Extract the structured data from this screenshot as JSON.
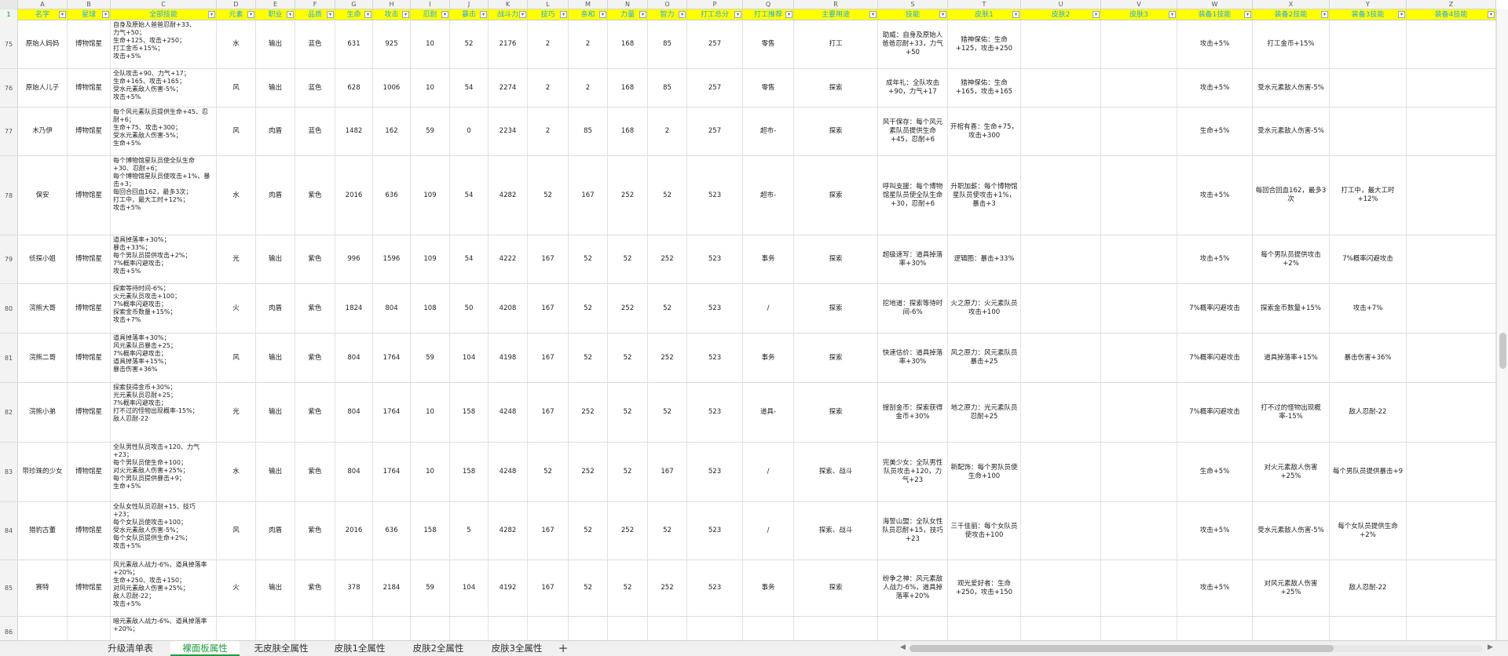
{
  "columns": [
    {
      "letter": "A",
      "header": "名字"
    },
    {
      "letter": "B",
      "header": "星球"
    },
    {
      "letter": "C",
      "header": "全部技能"
    },
    {
      "letter": "D",
      "header": "元素"
    },
    {
      "letter": "E",
      "header": "职业"
    },
    {
      "letter": "F",
      "header": "品质"
    },
    {
      "letter": "G",
      "header": "生命"
    },
    {
      "letter": "H",
      "header": "攻击"
    },
    {
      "letter": "I",
      "header": "忍耐"
    },
    {
      "letter": "J",
      "header": "暴击"
    },
    {
      "letter": "K",
      "header": "战斗力"
    },
    {
      "letter": "L",
      "header": "技巧"
    },
    {
      "letter": "M",
      "header": "亲和"
    },
    {
      "letter": "N",
      "header": "力量"
    },
    {
      "letter": "O",
      "header": "智力"
    },
    {
      "letter": "P",
      "header": "打工总分"
    },
    {
      "letter": "Q",
      "header": "打工推荐"
    },
    {
      "letter": "R",
      "header": "主要用途"
    },
    {
      "letter": "S",
      "header": "技能"
    },
    {
      "letter": "T",
      "header": "皮肤1"
    },
    {
      "letter": "U",
      "header": "皮肤2"
    },
    {
      "letter": "V",
      "header": "皮肤3"
    },
    {
      "letter": "W",
      "header": "装备1技能"
    },
    {
      "letter": "X",
      "header": "装备2技能"
    },
    {
      "letter": "Y",
      "header": "装备3技能"
    },
    {
      "letter": "Z",
      "header": "装备4技能"
    }
  ],
  "header_row_number": "1",
  "rows": [
    {
      "num": "75",
      "cells": [
        "原始人妈妈",
        "博物馆星",
        "自身及原始人爸爸忍耐+33、\n力气+50；\n生命+125、攻击+250；\n打工金币+15%；\n攻击+5%",
        "水",
        "输出",
        "蓝色",
        "631",
        "925",
        "10",
        "52",
        "2176",
        "2",
        "2",
        "168",
        "85",
        "257",
        "零售",
        "打工",
        "助威：自身及原始人爸爸忍耐+33，力气+50",
        "猎神保佑：生命+125，攻击+250",
        "",
        "",
        "攻击+5%",
        "打工金币+15%",
        "",
        ""
      ]
    },
    {
      "num": "76",
      "cells": [
        "原始人儿子",
        "博物馆星",
        "全队攻击+90、力气+17；\n生命+165、攻击+165；\n受水元素敌人伤害-5%；\n攻击+5%",
        "风",
        "输出",
        "蓝色",
        "628",
        "1006",
        "10",
        "54",
        "2274",
        "2",
        "2",
        "168",
        "85",
        "257",
        "零售",
        "探索",
        "成年礼：全队攻击+90，力气+17",
        "猎神保佑：生命+165，攻击+165",
        "",
        "",
        "攻击+5%",
        "受水元素敌人伤害-5%",
        "",
        ""
      ]
    },
    {
      "num": "77",
      "cells": [
        "木乃伊",
        "博物馆星",
        "每个风元素队员提供生命+45、忍耐+6；\n生命+75、攻击+300；\n受水元素敌人伤害-5%；\n生命+5%",
        "风",
        "肉盾",
        "蓝色",
        "1482",
        "162",
        "59",
        "0",
        "2234",
        "2",
        "85",
        "168",
        "2",
        "257",
        "超市-",
        "探索",
        "风干保存：每个风元素队员提供生命+45，忍耐+6",
        "开棺有喜：生命+75，攻击+300",
        "",
        "",
        "生命+5%",
        "受水元素敌人伤害-5%",
        "",
        ""
      ]
    },
    {
      "num": "78",
      "cells": [
        "保安",
        "博物馆星",
        "每个博物馆星队员使全队生命+30、忍耐+6；\n每个博物馆星队员使攻击+1%、暴击+3；\n每回合回血162，最多3次；\n打工中，最大工时+12%；\n攻击+5%",
        "水",
        "肉盾",
        "紫色",
        "2016",
        "636",
        "109",
        "54",
        "4282",
        "52",
        "167",
        "252",
        "52",
        "523",
        "超市-",
        "探索",
        "呼叫支援：每个博物馆星队员使全队生命+30，忍耐+6",
        "升职加薪：每个博物馆星队员使攻击+1%，暴击+3",
        "",
        "",
        "攻击+5%",
        "每回合回血162，最多3次",
        "打工中，最大工时+12%",
        ""
      ]
    },
    {
      "num": "79",
      "cells": [
        "侦探小姐",
        "博物馆星",
        "道具掉落率+30%；\n暴击+33%；\n每个男队员提供攻击+2%；\n7%概率闪避攻击；\n攻击+5%",
        "光",
        "输出",
        "紫色",
        "996",
        "1596",
        "109",
        "54",
        "4222",
        "167",
        "52",
        "52",
        "252",
        "523",
        "事务",
        "探索",
        "超级速写：道具掉落率+30%",
        "逻辑图：暴击+33%",
        "",
        "",
        "攻击+5%",
        "每个男队员提供攻击+2%",
        "7%概率闪避攻击",
        ""
      ]
    },
    {
      "num": "80",
      "cells": [
        "浣熊大哥",
        "博物馆星",
        "探索等待时间-6%；\n火元素队员攻击+100；\n7%概率闪避攻击；\n探索金币数量+15%；\n攻击+7%",
        "火",
        "肉盾",
        "紫色",
        "1824",
        "804",
        "108",
        "50",
        "4208",
        "167",
        "52",
        "252",
        "52",
        "523",
        "/",
        "探索",
        "挖地道：探索等待时间-6%",
        "火之原力：火元素队员攻击+100",
        "",
        "",
        "7%概率闪避攻击",
        "探索金币数量+15%",
        "攻击+7%",
        ""
      ]
    },
    {
      "num": "81",
      "cells": [
        "浣熊二哥",
        "博物馆星",
        "道具掉落率+30%；\n风元素队员暴击+25；\n7%概率闪避攻击；\n道具掉落率+15%；\n暴击伤害+36%",
        "风",
        "输出",
        "紫色",
        "804",
        "1764",
        "59",
        "104",
        "4198",
        "167",
        "52",
        "52",
        "252",
        "523",
        "事务",
        "探索",
        "快速估价：道具掉落率+30%",
        "风之原力：风元素队员暴击+25",
        "",
        "",
        "7%概率闪避攻击",
        "道具掉落率+15%",
        "暴击伤害+36%",
        ""
      ]
    },
    {
      "num": "82",
      "cells": [
        "浣熊小弟",
        "博物馆星",
        "探索获得金币+30%；\n光元素队员忍耐+25；\n7%概率闪避攻击；\n打不过的怪物出现概率-15%；\n敌人忍耐-22",
        "光",
        "输出",
        "紫色",
        "804",
        "1764",
        "10",
        "158",
        "4248",
        "167",
        "252",
        "52",
        "52",
        "523",
        "道具-",
        "探索",
        "搜刮金币：探索获得金币+30%",
        "地之原力：光元素队员忍耐+25",
        "",
        "",
        "7%概率闪避攻击",
        "打不过的怪物出现概率-15%",
        "敌人忍耐-22",
        ""
      ]
    },
    {
      "num": "83",
      "cells": [
        "带珍珠的少女",
        "博物馆星",
        "全队男性队员攻击+120、力气+23；\n每个男队员使生命+100；\n对火元素敌人伤害+25%；\n每个男队员提供暴击+9；\n生命+5%",
        "水",
        "输出",
        "紫色",
        "804",
        "1764",
        "10",
        "158",
        "4248",
        "52",
        "252",
        "52",
        "167",
        "523",
        "/",
        "探索、战斗",
        "完美少女：全队男性队员攻击+120，力气+23",
        "新配饰：每个男队员使生命+100",
        "",
        "",
        "生命+5%",
        "对火元素敌人伤害+25%",
        "每个男队员提供暴击+9",
        ""
      ]
    },
    {
      "num": "84",
      "cells": [
        "猎豹古董",
        "博物馆星",
        "全队女性队员忍耐+15、技巧+23；\n每个女队员使攻击+100；\n受水元素敌人伤害-5%；\n每个女队员提供生命+2%；\n攻击+5%",
        "风",
        "肉盾",
        "紫色",
        "2016",
        "636",
        "158",
        "5",
        "4282",
        "167",
        "52",
        "252",
        "52",
        "523",
        "/",
        "探索、战斗",
        "海誓山盟：全队女性队员忍耐+15，技巧+23",
        "三千佳丽：每个女队员使攻击+100",
        "",
        "",
        "攻击+5%",
        "受水元素敌人伤害-5%",
        "每个女队员提供生命+2%",
        ""
      ]
    },
    {
      "num": "85",
      "cells": [
        "赛特",
        "博物馆星",
        "风元素敌人战力-6%、道具掉落率+20%；\n生命+250、攻击+150；\n对风元素敌人伤害+25%；\n敌人忍耐-22；\n攻击+5%",
        "火",
        "输出",
        "紫色",
        "378",
        "2184",
        "59",
        "104",
        "4192",
        "167",
        "52",
        "52",
        "252",
        "523",
        "事务",
        "探索",
        "纷争之神：风元素敌人战力-6%，道具掉落率+20%",
        "观光爱好者：生命+250，攻击+150",
        "",
        "",
        "攻击+5%",
        "对风元素敌人伤害+25%",
        "敌人忍耐-22",
        ""
      ]
    },
    {
      "num": "86",
      "cells": [
        "",
        "",
        "暗元素敌人战力-6%、道具掉落率+20%；",
        "",
        "",
        "",
        "",
        "",
        "",
        "",
        "",
        "",
        "",
        "",
        "",
        "",
        "",
        "",
        "",
        "",
        "",
        "",
        "",
        "",
        "",
        ""
      ]
    }
  ],
  "tabs": [
    {
      "label": "升级清单表"
    },
    {
      "label": "裸面板属性"
    },
    {
      "label": "无皮肤全属性"
    },
    {
      "label": "皮肤1全属性"
    },
    {
      "label": "皮肤2全属性"
    },
    {
      "label": "皮肤3全属性"
    }
  ],
  "active_tab": "裸面板属性",
  "add_tab_symbol": "+",
  "filter_symbol": "▾",
  "colors": {
    "header_bg": "#ffff00",
    "header_text": "#22a6ff",
    "active_tab": "#1e9e3e"
  }
}
